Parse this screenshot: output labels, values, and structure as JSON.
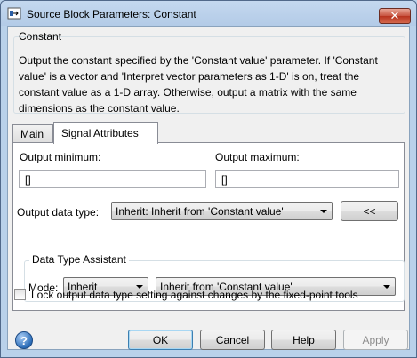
{
  "window": {
    "title": "Source Block Parameters: Constant",
    "close_glyph": "✕"
  },
  "block": {
    "group_title": "Constant",
    "description": "Output the constant specified by the 'Constant value' parameter. If 'Constant value' is a vector and 'Interpret vector parameters as 1-D' is on, treat the constant value as a 1-D array. Otherwise, output a matrix with the same dimensions as the constant value."
  },
  "tabs": [
    {
      "label": "Main",
      "active": false
    },
    {
      "label": "Signal Attributes",
      "active": true
    }
  ],
  "signal_attributes": {
    "output_minimum_label": "Output minimum:",
    "output_minimum_value": "[]",
    "output_maximum_label": "Output maximum:",
    "output_maximum_value": "[]",
    "output_data_type_label": "Output data type:",
    "output_data_type_value": "Inherit: Inherit from 'Constant value'",
    "assistant_toggle_label": "<<",
    "assistant": {
      "title": "Data Type Assistant",
      "mode_label": "Mode:",
      "mode_value": "Inherit",
      "inherit_value": "Inherit from 'Constant value'"
    },
    "lock_label": "Lock output data type setting against changes by the fixed-point tools",
    "lock_checked": false
  },
  "buttons": {
    "ok": "OK",
    "cancel": "Cancel",
    "help": "Help",
    "apply": "Apply"
  },
  "help_icon_glyph": "?",
  "colors": {
    "frame": "#b9d1ea",
    "dialog_bg": "#f0f0f0",
    "close_button": "#c7533f"
  }
}
